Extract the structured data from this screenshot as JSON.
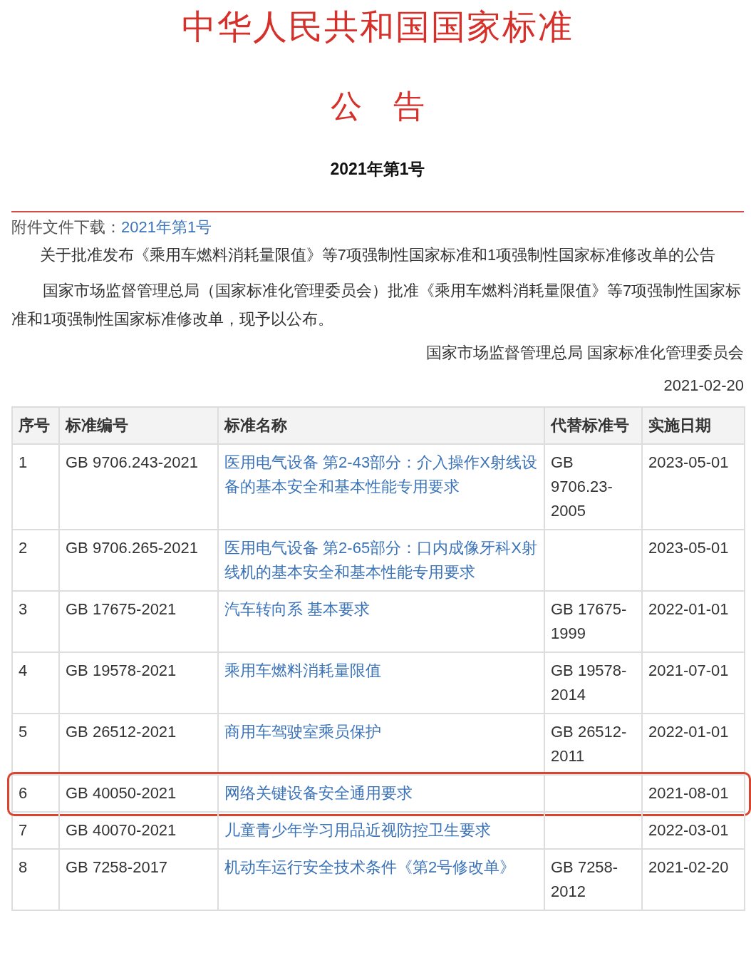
{
  "header": {
    "title": "中华人民共和国国家标准",
    "subtitle": "公　告",
    "number": "2021年第1号"
  },
  "attachment": {
    "label": "附件文件下载：",
    "link": "2021年第1号"
  },
  "notice_title": "关于批准发布《乘用车燃料消耗量限值》等7项强制性国家标准和1项强制性国家标准修改单的公告",
  "body": "国家市场监督管理总局（国家标准化管理委员会）批准《乘用车燃料消耗量限值》等7项强制性国家标准和1项强制性国家标准修改单，现予以公布。",
  "signature": "国家市场监督管理总局 国家标准化管理委员会",
  "date": "2021-02-20",
  "table": {
    "columns": [
      "序号",
      "标准编号",
      "标准名称",
      "代替标准号",
      "实施日期"
    ],
    "rows": [
      {
        "no": "1",
        "code": "GB 9706.243-2021",
        "name": "医用电气设备 第2-43部分：介入操作X射线设备的基本安全和基本性能专用要求",
        "replaces": "GB 9706.23-2005",
        "date": "2023-05-01",
        "highlighted": false
      },
      {
        "no": "2",
        "code": "GB 9706.265-2021",
        "name": "医用电气设备 第2-65部分：口内成像牙科X射线机的基本安全和基本性能专用要求",
        "date": "2023-05-01",
        "highlighted": false
      },
      {
        "no": "3",
        "code": "GB 17675-2021",
        "name": "汽车转向系 基本要求",
        "replaces": "GB 17675-1999",
        "date": "2022-01-01",
        "highlighted": false
      },
      {
        "no": "4",
        "code": "GB 19578-2021",
        "name": "乘用车燃料消耗量限值",
        "replaces": "GB 19578-2014",
        "date": "2021-07-01",
        "highlighted": false
      },
      {
        "no": "5",
        "code": "GB 26512-2021",
        "name": "商用车驾驶室乘员保护",
        "replaces": "GB 26512-2011",
        "date": "2022-01-01",
        "highlighted": false
      },
      {
        "no": "6",
        "code": "GB 40050-2021",
        "name": "网络关键设备安全通用要求",
        "date": "2021-08-01",
        "highlighted": true
      },
      {
        "no": "7",
        "code": "GB 40070-2021",
        "name": "儿童青少年学习用品近视防控卫生要求",
        "date": "2022-03-01",
        "highlighted": false
      },
      {
        "no": "8",
        "code": "GB 7258-2017",
        "name": "机动车运行安全技术条件《第2号修改单》",
        "replaces": "GB 7258-2012",
        "date": "2021-02-20",
        "highlighted": false
      }
    ]
  }
}
